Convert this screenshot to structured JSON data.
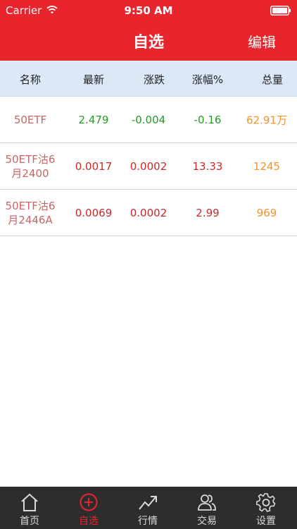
{
  "status_bar": {
    "carrier": "Carrier",
    "time": "9:50 AM"
  },
  "nav": {
    "title": "自选",
    "edit": "编辑"
  },
  "columns": [
    "名称",
    "最新",
    "涨跌",
    "涨幅%",
    "总量"
  ],
  "rows": [
    {
      "name": "50ETF",
      "latest": "2.479",
      "change": "-0.004",
      "pct": "-0.16",
      "volume": "62.91万"
    },
    {
      "name": "50ETF沽6月2400",
      "latest": "0.0017",
      "change": "0.0002",
      "pct": "13.33",
      "volume": "1245"
    },
    {
      "name": "50ETF沽6月2446A",
      "latest": "0.0069",
      "change": "0.0002",
      "pct": "2.99",
      "volume": "969"
    }
  ],
  "tabs": [
    {
      "label": "首页",
      "icon": "home-icon"
    },
    {
      "label": "自选",
      "icon": "plus-circle-icon"
    },
    {
      "label": "行情",
      "icon": "trend-icon"
    },
    {
      "label": "交易",
      "icon": "people-icon"
    },
    {
      "label": "设置",
      "icon": "gear-icon"
    }
  ],
  "colors": {
    "brand": "#e8242c",
    "up": "#c62b2b",
    "down": "#2b9a2b",
    "volume": "#f3922e"
  }
}
